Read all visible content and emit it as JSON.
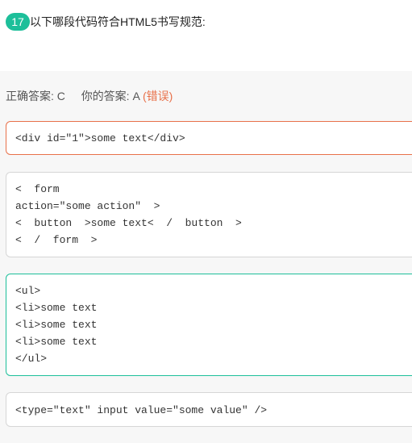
{
  "question": {
    "number": "17",
    "text": "以下哪段代码符合HTML5书写规范:"
  },
  "answer": {
    "correct_label": "正确答案:",
    "correct_value": "C",
    "yours_label": "你的答案:",
    "yours_value": "A",
    "result": "(错误)"
  },
  "options": [
    {
      "lines": [
        "<div id=\"1\">some text</div>"
      ]
    },
    {
      "lines": [
        "<  form",
        "action=\"some action\"  >",
        "<  button  >some text<  /  button  >",
        "<  /  form  >"
      ]
    },
    {
      "lines": [
        "<ul>",
        "<li>some text",
        "<li>some text",
        "<li>some text",
        "</ul>"
      ]
    },
    {
      "lines": [
        "<type=\"text\" input value=\"some value\" />"
      ]
    }
  ],
  "colors": {
    "accent": "#1dbf9a",
    "error": "#e8714a"
  }
}
